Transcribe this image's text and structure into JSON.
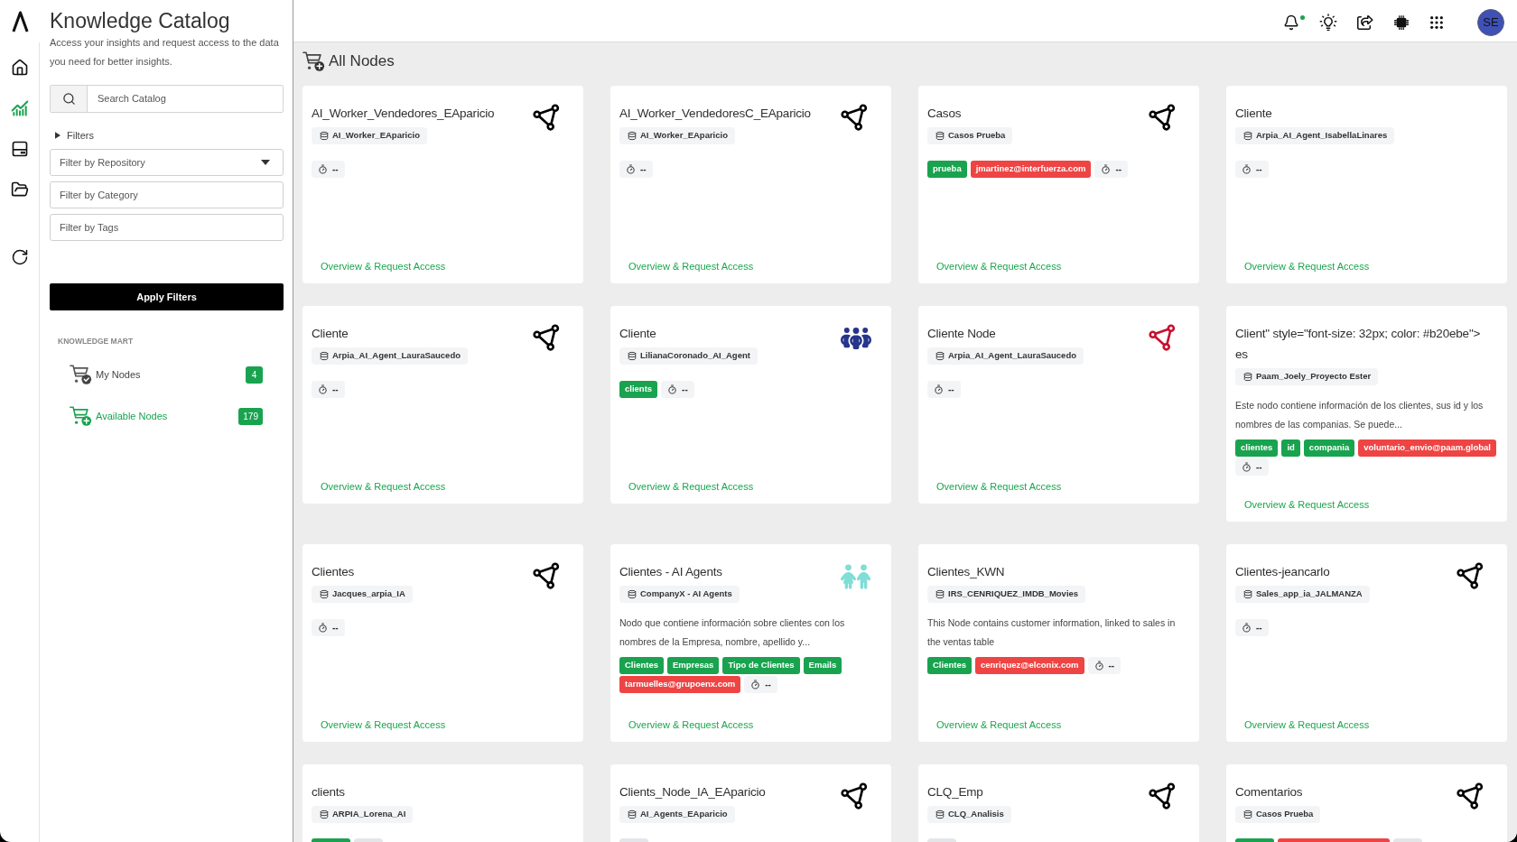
{
  "rail": [
    {
      "selected": false
    },
    {
      "selected": true
    },
    {
      "selected": false
    },
    {
      "selected": false
    }
  ],
  "sidebar": {
    "title": "Knowledge Catalog",
    "description": "Access your insights and request access to the data you need for better insights.",
    "search": {
      "placeholder": "Search Catalog"
    },
    "filters": {
      "label": "Filters",
      "expanded": false
    },
    "filter_fields": [
      {
        "kind": "select",
        "placeholder": "Filter by Repository"
      },
      {
        "kind": "input",
        "placeholder": "Filter by Category"
      },
      {
        "kind": "input",
        "placeholder": "Filter by Tags"
      }
    ],
    "apply_button": "Apply Filters",
    "section_title": "KNOWLEDGE MART",
    "mart_items": [
      {
        "label": "My Nodes",
        "count": "4",
        "selected": false
      },
      {
        "label": "Available Nodes",
        "count": "179",
        "selected": true
      }
    ]
  },
  "topbar": {
    "notifications": {
      "unread": true
    },
    "avatar": "SE"
  },
  "main": {
    "heading": "All Nodes",
    "cards": [
      {
        "title": "AI_Worker_Vendedores_EAparicio",
        "repository": "AI_Worker_EAparicio",
        "timer": "--",
        "icon": {
          "kind": "graph",
          "color": "#000000"
        },
        "link": "Overview & Request Access"
      },
      {
        "title": "AI_Worker_VendedoresC_EAparicio",
        "repository": "AI_Worker_EAparicio",
        "timer": "--",
        "icon": {
          "kind": "graph",
          "color": "#000000"
        },
        "link": "Overview & Request Access"
      },
      {
        "title": "Casos",
        "repository": "Casos Prueba",
        "tags": [
          {
            "label": "prueba",
            "color": "#19a34f"
          },
          {
            "label": "jmartinez@interfuerza.com",
            "color": "#ef4444"
          }
        ],
        "timer": "--",
        "icon": {
          "kind": "graph",
          "color": "#000000"
        },
        "link": "Overview & Request Access"
      },
      {
        "title": "Cliente",
        "repository": "Arpia_AI_Agent_IsabellaLinares",
        "timer": "--",
        "link": "Overview & Request Access"
      },
      {
        "title": "Cliente",
        "repository": "Arpia_AI_Agent_LauraSaucedo",
        "timer": "--",
        "icon": {
          "kind": "graph",
          "color": "#000000"
        },
        "link": "Overview & Request Access"
      },
      {
        "title": "Cliente",
        "repository": "LilianaCoronado_AI_Agent",
        "tags": [
          {
            "label": "clients",
            "color": "#19a34f"
          }
        ],
        "timer": "--",
        "icon": {
          "kind": "group",
          "color": "#27348b"
        },
        "link": "Overview & Request Access"
      },
      {
        "title": "Cliente Node",
        "repository": "Arpia_AI_Agent_LauraSaucedo",
        "timer": "--",
        "icon": {
          "kind": "graph",
          "color": "#c8102e"
        },
        "link": "Overview & Request Access"
      },
      {
        "title": "Client\" style=\"font-size: 32px; color: #b20ebe\"> es",
        "repository": "Paam_Joely_Proyecto Ester",
        "description": "Este nodo contiene información de los clientes, sus id y los nombres de las companias. Se puede...",
        "tags": [
          {
            "label": "clientes",
            "color": "#19a34f"
          },
          {
            "label": "id",
            "color": "#19a34f"
          },
          {
            "label": "compania",
            "color": "#19a34f"
          },
          {
            "label": "voluntario_envio@paam.global",
            "color": "#ef4444"
          }
        ],
        "timer": "--",
        "link": "Overview & Request Access"
      },
      {
        "title": "Clientes",
        "repository": "Jacques_arpia_IA",
        "timer": "--",
        "icon": {
          "kind": "graph",
          "color": "#000000"
        },
        "link": "Overview & Request Access"
      },
      {
        "title": "Clientes - AI Agents",
        "repository": "CompanyX - AI Agents",
        "description": "Nodo que contiene información sobre clientes con los nombres de la Empresa, nombre, apellido y...",
        "tags": [
          {
            "label": "Clientes",
            "color": "#19a34f"
          },
          {
            "label": "Empresas",
            "color": "#19a34f"
          },
          {
            "label": "Tipo de Clientes",
            "color": "#19a34f"
          },
          {
            "label": "Emails",
            "color": "#19a34f"
          },
          {
            "label": "tarmuelles@grupoenx.com",
            "color": "#ef4444"
          }
        ],
        "timer": "--",
        "icon": {
          "kind": "pair",
          "color": "#7fded6"
        },
        "link": "Overview & Request Access"
      },
      {
        "title": "Clientes_KWN",
        "repository": "IRS_CENRIQUEZ_IMDB_Movies",
        "description": "This Node contains customer information, linked to sales in the ventas table",
        "tags": [
          {
            "label": "Clientes",
            "color": "#19a34f"
          },
          {
            "label": "cenriquez@elconix.com",
            "color": "#ef4444"
          }
        ],
        "timer": "--",
        "link": "Overview & Request Access"
      },
      {
        "title": "Clientes-jeancarlo",
        "repository": "Sales_app_ia_JALMANZA",
        "timer": "--",
        "icon": {
          "kind": "graph",
          "color": "#000000"
        },
        "link": "Overview & Request Access"
      },
      {
        "title": "clients",
        "repository": "ARPIA_Lorena_AI",
        "chips_cut_off": [
          {
            "kind": "tag",
            "color": "#19a34f"
          },
          {
            "kind": "timer"
          }
        ]
      },
      {
        "title": "Clients_Node_IA_EAparicio",
        "repository": "AI_Agents_EAparicio",
        "chips_cut_off": [
          {
            "kind": "timer"
          }
        ],
        "icon": {
          "kind": "graph",
          "color": "#000000"
        }
      },
      {
        "title": "CLQ_Emp",
        "repository": "CLQ_Analisis",
        "chips_cut_off": [
          {
            "kind": "timer"
          }
        ],
        "icon": {
          "kind": "graph",
          "color": "#000000"
        }
      },
      {
        "title": "Comentarios",
        "repository": "Casos Prueba",
        "chips_cut_off": [
          {
            "kind": "tag",
            "color": "#19a34f"
          },
          {
            "kind": "email",
            "color": "#ef4444"
          },
          {
            "kind": "timer"
          }
        ],
        "icon": {
          "kind": "graph",
          "color": "#000000"
        }
      }
    ]
  }
}
